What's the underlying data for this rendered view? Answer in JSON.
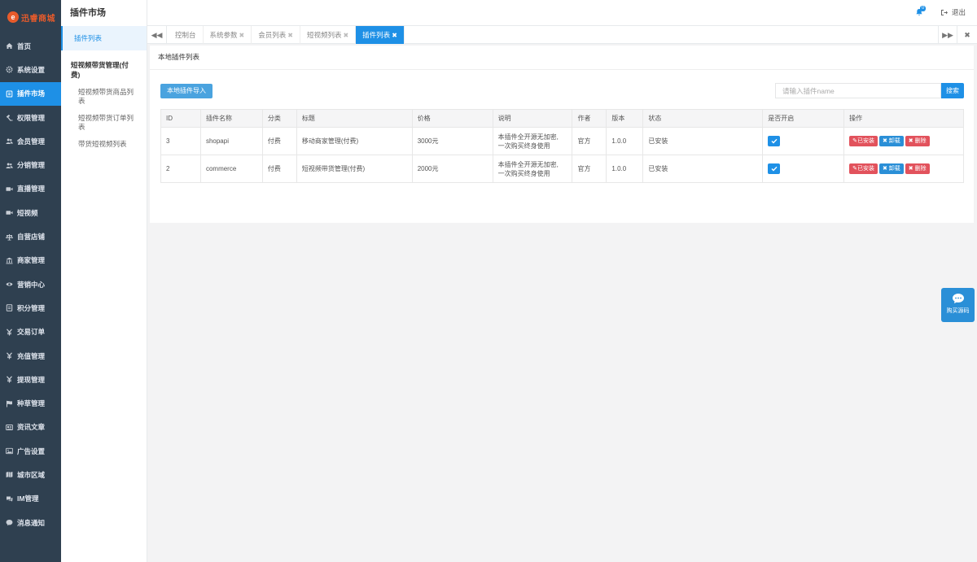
{
  "brand": {
    "logo_mark": "e",
    "logo_text": "迅睿商城",
    "accent": "#1e90e6",
    "sidebar_bg": "#2f4050"
  },
  "sidebar": {
    "items": [
      {
        "label": "首页",
        "icon": "home-icon"
      },
      {
        "label": "系统设置",
        "icon": "gear-icon"
      },
      {
        "label": "插件市场",
        "icon": "plugin-icon",
        "active": true
      },
      {
        "label": "权限管理",
        "icon": "gavel-icon"
      },
      {
        "label": "会员管理",
        "icon": "users-icon"
      },
      {
        "label": "分销管理",
        "icon": "users-icon"
      },
      {
        "label": "直播管理",
        "icon": "video-icon"
      },
      {
        "label": "短视频",
        "icon": "video-icon"
      },
      {
        "label": "自营店铺",
        "icon": "balance-icon"
      },
      {
        "label": "商家管理",
        "icon": "bank-icon"
      },
      {
        "label": "营销中心",
        "icon": "eye-icon"
      },
      {
        "label": "积分管理",
        "icon": "file-icon"
      },
      {
        "label": "交易订单",
        "icon": "yen-icon"
      },
      {
        "label": "充值管理",
        "icon": "yen-icon"
      },
      {
        "label": "提现管理",
        "icon": "yen-icon"
      },
      {
        "label": "种草管理",
        "icon": "flag-icon"
      },
      {
        "label": "资讯文章",
        "icon": "newspaper-icon"
      },
      {
        "label": "广告设置",
        "icon": "image-icon"
      },
      {
        "label": "城市区域",
        "icon": "map-icon"
      },
      {
        "label": "IM管理",
        "icon": "comments-icon"
      },
      {
        "label": "消息通知",
        "icon": "comment-icon"
      }
    ]
  },
  "submenu": {
    "title": "插件市场",
    "active_item": "插件列表",
    "group": "短视频带货管理(付费)",
    "children": [
      "短视频带货商品列表",
      "短视频带货订单列表",
      "带货短视频列表"
    ]
  },
  "header": {
    "badge": "0",
    "logout": "退出"
  },
  "tabs": [
    {
      "label": "控制台",
      "closable": false
    },
    {
      "label": "系统参数",
      "closable": true
    },
    {
      "label": "会员列表",
      "closable": true
    },
    {
      "label": "短视频列表",
      "closable": true
    },
    {
      "label": "插件列表",
      "closable": true,
      "active": true
    }
  ],
  "panel": {
    "title": "本地插件列表",
    "import_button": "本地插件导入",
    "search_placeholder": "请输入插件name",
    "search_button": "搜索"
  },
  "table": {
    "columns": [
      "ID",
      "插件名称",
      "分类",
      "标题",
      "价格",
      "说明",
      "作者",
      "版本",
      "状态",
      "是否开启",
      "操作"
    ],
    "rows": [
      {
        "id": "3",
        "name": "shopapi",
        "category": "付费",
        "title": "移动商家管理(付费)",
        "price": "3000元",
        "desc_1": "本插件全开源无加密,",
        "desc_2": "一次购买终身使用",
        "author": "官方",
        "version": "1.0.0",
        "status": "已安装",
        "enabled": true
      },
      {
        "id": "2",
        "name": "commerce",
        "category": "付费",
        "title": "短视频带货管理(付费)",
        "price": "2000元",
        "desc_1": "本插件全开源无加密,",
        "desc_2": "一次购买终身使用",
        "author": "官方",
        "version": "1.0.0",
        "status": "已安装",
        "enabled": true
      }
    ],
    "actions": {
      "installed": "已安装",
      "uninstall": "卸载",
      "delete": "删除"
    }
  },
  "float_button": {
    "label": "购买源码"
  }
}
